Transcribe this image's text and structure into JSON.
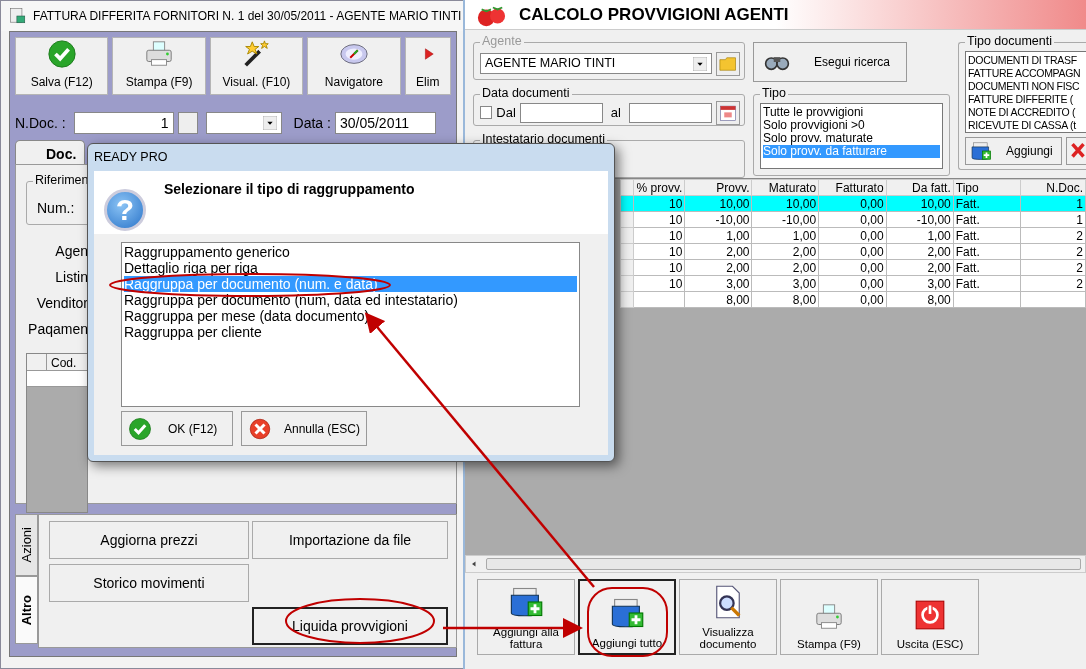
{
  "left_window": {
    "title": "FATTURA DIFFERITA FORNITORI N. 1  del 30/05/2011 - AGENTE MARIO TINTI",
    "toolbar": [
      "Salva (F12)",
      "Stampa (F9)",
      "Visual. (F10)",
      "Navigatore",
      "Elim"
    ],
    "ndoc": {
      "label": "N.Doc. :",
      "value": "1"
    },
    "date": {
      "label": "Data :",
      "value": "30/05/2011"
    },
    "tabs": [
      {
        "label": "Doc.",
        "selected": true
      }
    ],
    "reference_group": {
      "legend": "Riferimen",
      "num_label": "Num.:"
    },
    "field_labels": [
      "Agen",
      "Listin",
      "Venditor",
      "Paqamen"
    ],
    "grid": {
      "columns": [
        "Cod."
      ]
    },
    "side_tabs": [
      {
        "label": "Azioni",
        "selected": false
      },
      {
        "label": "Altro",
        "selected": true
      }
    ],
    "action_buttons": [
      {
        "label": "Aggiorna prezzi",
        "focused": false
      },
      {
        "label": "Importazione da file",
        "focused": false
      },
      {
        "label": "Storico movimenti",
        "focused": false
      },
      {
        "label": "Liquida provvigioni",
        "focused": true
      }
    ]
  },
  "right_window": {
    "title": "CALCOLO PROVVIGIONI AGENTI",
    "agent": {
      "legend": "Agente",
      "value": "AGENTE MARIO TINTI"
    },
    "date_group": {
      "legend": "Data documenti",
      "checked": false,
      "from_label": "Dal",
      "to_label": "al"
    },
    "holder": {
      "legend": "Intestatario documenti"
    },
    "search_button": "Esegui ricerca",
    "type_group": {
      "legend": "Tipo",
      "items": [
        {
          "label": "Tutte le provvigioni",
          "selected": false
        },
        {
          "label": "Solo provvigioni >0",
          "selected": false
        },
        {
          "label": "Solo provv. maturate",
          "selected": false
        },
        {
          "label": "Solo provv. da fatturare",
          "selected": true
        }
      ]
    },
    "doc_types": {
      "legend": "Tipo documenti",
      "items": [
        "DOCUMENTI DI TRASF",
        "FATTURE ACCOMPAGN",
        "DOCUMENTI NON FISC",
        "FATTURE DIFFERITE (",
        "NOTE DI ACCREDITO (",
        "RICEVUTE DI CASSA (t"
      ],
      "add_button": "Aggiungi"
    },
    "table": {
      "columns": [
        "% provv.",
        "Provv.",
        "Maturato",
        "Fatturato",
        "Da fatt.",
        "Tipo",
        "N.Doc."
      ],
      "rows": [
        {
          "selected": true,
          "cells": [
            "10",
            "10,00",
            "10,00",
            "0,00",
            "10,00",
            "Fatt.",
            "1"
          ]
        },
        {
          "selected": false,
          "cells": [
            "10",
            "-10,00",
            "-10,00",
            "0,00",
            "-10,00",
            "Fatt.",
            "1"
          ]
        },
        {
          "selected": false,
          "cells": [
            "10",
            "1,00",
            "1,00",
            "0,00",
            "1,00",
            "Fatt.",
            "2"
          ]
        },
        {
          "selected": false,
          "cells": [
            "10",
            "2,00",
            "2,00",
            "0,00",
            "2,00",
            "Fatt.",
            "2"
          ]
        },
        {
          "selected": false,
          "cells": [
            "10",
            "2,00",
            "2,00",
            "0,00",
            "2,00",
            "Fatt.",
            "2"
          ]
        },
        {
          "selected": false,
          "cells": [
            "10",
            "3,00",
            "3,00",
            "0,00",
            "3,00",
            "Fatt.",
            "2"
          ]
        },
        {
          "selected": false,
          "cells": [
            "",
            "8,00",
            "8,00",
            "0,00",
            "8,00",
            "",
            ""
          ]
        }
      ]
    },
    "buttons": [
      {
        "label": "Aggiungi alla fattura",
        "focused": false
      },
      {
        "label": "Aggiungi tutto",
        "focused": true
      },
      {
        "label": "Visualizza documento",
        "focused": false
      },
      {
        "label": "Stampa (F9)",
        "focused": false
      },
      {
        "label": "Uscita (ESC)",
        "focused": false
      }
    ]
  },
  "dialog": {
    "title": "READY PRO",
    "icon_char": "?",
    "heading": "Selezionare il tipo di raggruppamento",
    "options": [
      {
        "label": "Raggruppamento generico",
        "selected": false
      },
      {
        "label": "Dettaglio riga per riga",
        "selected": false
      },
      {
        "label": "Raggruppa per documento (num. e data)",
        "selected": true
      },
      {
        "label": "Raggruppa per documento (num, data ed intestatario)",
        "selected": false
      },
      {
        "label": "Raggruppa per mese (data documento)",
        "selected": false
      },
      {
        "label": "Raggruppa per cliente",
        "selected": false
      }
    ],
    "ok_button": "OK (F12)",
    "cancel_button": "Annulla (ESC)"
  }
}
